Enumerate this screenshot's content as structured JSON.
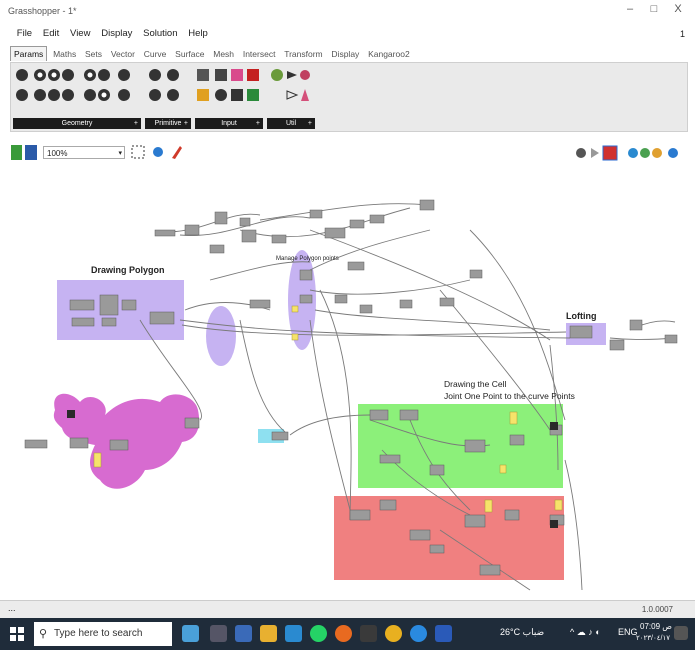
{
  "window": {
    "title": "Grasshopper - 1*",
    "controls": [
      "–",
      "□",
      "X"
    ]
  },
  "menu": {
    "items": [
      "File",
      "Edit",
      "View",
      "Display",
      "Solution",
      "Help"
    ],
    "right_text": "1"
  },
  "tabs": [
    "Params",
    "Maths",
    "Sets",
    "Vector",
    "Curve",
    "Surface",
    "Mesh",
    "Intersect",
    "Transform",
    "Display",
    "Kangaroo2"
  ],
  "active_tab": "Params",
  "ribbon_groups": [
    {
      "label": "Geometry",
      "plus": "+"
    },
    {
      "label": "Primitive",
      "plus": "+"
    },
    {
      "label": "Input",
      "plus": "+"
    },
    {
      "label": "Util",
      "plus": "+"
    }
  ],
  "toolbar": {
    "zoom": "100%",
    "dropdown_icon": "chevron-down-icon"
  },
  "canvas": {
    "groups": [
      {
        "name": "drawing-polygon",
        "label": "Drawing Polygon",
        "color": "#c6b3f2"
      },
      {
        "name": "manage-points",
        "label": "Manage Polygon points",
        "color": "#c6b3f2"
      },
      {
        "name": "lofting",
        "label": "Lofting",
        "color": "#c6b3f2"
      },
      {
        "name": "drawing-cell",
        "label": "Drawing the Cell",
        "color": "#8cf07a"
      },
      {
        "name": "joint-points",
        "label": "Joint One Point to the curve Points",
        "color": "#8cf07a"
      },
      {
        "name": "red-group",
        "label": "",
        "color": "#f08080"
      },
      {
        "name": "blob-group",
        "label": "",
        "color": "#d76bd0"
      }
    ]
  },
  "status": {
    "left": "...",
    "version": "1.0.0007"
  },
  "taskbar": {
    "search_placeholder": "Type here to search",
    "weather": "26°C  ضباب",
    "lang": "ENG",
    "time": "07:09 ص",
    "date": "٢٠٢٣/٠٤/١٧"
  },
  "colors": {
    "purple_group": "#c6b3f2",
    "green_group": "#8cf07a",
    "red_group": "#f08080",
    "blob": "#d76bd0",
    "taskbar": "#1f2c3a"
  }
}
